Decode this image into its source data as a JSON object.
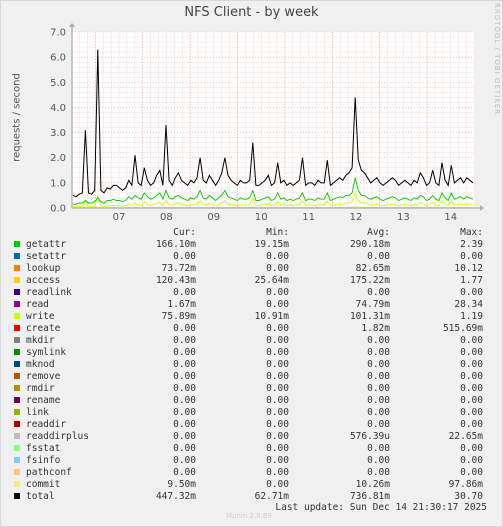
{
  "chart_data": {
    "type": "line",
    "title": "NFS Client - by week",
    "ylabel": "requests / second",
    "ylim": [
      0,
      7
    ],
    "yticks": [
      "0.0",
      "1.0",
      "2.0",
      "3.0",
      "4.0",
      "5.0",
      "6.0",
      "7.0"
    ],
    "x_day_labels": [
      "07",
      "08",
      "09",
      "10",
      "11",
      "12",
      "13",
      "14"
    ],
    "grid": true,
    "series": [
      {
        "name": "total",
        "color": "#000000",
        "values": [
          0.5,
          0.45,
          0.55,
          0.6,
          3.1,
          0.6,
          0.55,
          0.7,
          6.3,
          0.7,
          0.6,
          0.8,
          0.75,
          0.9,
          0.9,
          0.8,
          0.7,
          0.8,
          1.1,
          0.9,
          2.1,
          1.0,
          0.9,
          1.6,
          1.1,
          0.9,
          1.0,
          1.3,
          1.5,
          0.9,
          3.3,
          1.1,
          0.9,
          1.2,
          1.4,
          1.1,
          1.0,
          0.9,
          1.1,
          1.0,
          1.2,
          2.0,
          1.1,
          1.0,
          1.3,
          1.1,
          0.9,
          1.1,
          1.4,
          2.0,
          1.3,
          1.1,
          1.0,
          0.9,
          1.1,
          1.0,
          1.0,
          1.1,
          2.6,
          0.9,
          0.9,
          1.0,
          1.1,
          1.3,
          0.9,
          1.0,
          1.8,
          1.0,
          1.1,
          0.9,
          1.0,
          0.9,
          1.0,
          1.1,
          2.0,
          0.9,
          1.0,
          1.0,
          0.9,
          1.1,
          1.0,
          1.0,
          1.9,
          0.9,
          1.0,
          1.1,
          1.2,
          1.1,
          1.3,
          1.4,
          1.6,
          4.4,
          1.9,
          1.5,
          1.4,
          1.2,
          1.0,
          1.1,
          1.2,
          1.0,
          0.9,
          1.0,
          1.1,
          1.2,
          1.1,
          0.9,
          1.0,
          1.1,
          1.0,
          0.9,
          1.1,
          1.0,
          1.4,
          1.2,
          0.9,
          1.0,
          1.5,
          1.0,
          0.9,
          1.8,
          1.1,
          0.9,
          1.7,
          1.0,
          1.1,
          1.2,
          1.0,
          1.2,
          1.1,
          1.0
        ]
      },
      {
        "name": "getattr",
        "color": "#00cc00",
        "values": [
          0.15,
          0.15,
          0.2,
          0.2,
          0.3,
          0.2,
          0.2,
          0.25,
          0.4,
          0.25,
          0.2,
          0.3,
          0.3,
          0.35,
          0.3,
          0.3,
          0.25,
          0.3,
          0.45,
          0.35,
          0.5,
          0.4,
          0.35,
          0.6,
          0.45,
          0.35,
          0.4,
          0.5,
          0.6,
          0.35,
          0.7,
          0.4,
          0.35,
          0.45,
          0.5,
          0.4,
          0.35,
          0.3,
          0.4,
          0.35,
          0.45,
          0.7,
          0.4,
          0.35,
          0.5,
          0.4,
          0.3,
          0.4,
          0.5,
          0.7,
          0.45,
          0.4,
          0.35,
          0.3,
          0.4,
          0.35,
          0.35,
          0.4,
          0.7,
          0.3,
          0.3,
          0.35,
          0.4,
          0.45,
          0.3,
          0.35,
          0.6,
          0.35,
          0.4,
          0.3,
          0.35,
          0.3,
          0.35,
          0.4,
          0.6,
          0.3,
          0.35,
          0.35,
          0.3,
          0.4,
          0.35,
          0.35,
          0.6,
          0.3,
          0.35,
          0.4,
          0.45,
          0.4,
          0.5,
          0.5,
          0.6,
          1.2,
          0.7,
          0.5,
          0.5,
          0.4,
          0.35,
          0.4,
          0.45,
          0.35,
          0.3,
          0.35,
          0.4,
          0.45,
          0.4,
          0.3,
          0.35,
          0.4,
          0.35,
          0.3,
          0.4,
          0.35,
          0.5,
          0.45,
          0.3,
          0.35,
          0.5,
          0.35,
          0.3,
          0.6,
          0.4,
          0.3,
          0.6,
          0.35,
          0.4,
          0.45,
          0.35,
          0.45,
          0.4,
          0.35
        ]
      },
      {
        "name": "write",
        "color": "#ccff00",
        "values": [
          0.05,
          0.05,
          0.06,
          0.06,
          0.3,
          0.06,
          0.05,
          0.07,
          0.5,
          0.08,
          0.06,
          0.09,
          0.08,
          0.1,
          0.1,
          0.09,
          0.08,
          0.09,
          0.15,
          0.1,
          0.2,
          0.12,
          0.1,
          0.25,
          0.14,
          0.1,
          0.12,
          0.18,
          0.22,
          0.1,
          0.3,
          0.13,
          0.1,
          0.16,
          0.2,
          0.13,
          0.12,
          0.1,
          0.13,
          0.12,
          0.16,
          0.3,
          0.13,
          0.12,
          0.18,
          0.13,
          0.1,
          0.13,
          0.2,
          0.3,
          0.16,
          0.13,
          0.12,
          0.1,
          0.13,
          0.12,
          0.12,
          0.13,
          0.4,
          0.1,
          0.1,
          0.12,
          0.13,
          0.16,
          0.1,
          0.12,
          0.25,
          0.12,
          0.13,
          0.1,
          0.12,
          0.1,
          0.12,
          0.13,
          0.3,
          0.1,
          0.12,
          0.12,
          0.1,
          0.13,
          0.12,
          0.12,
          0.28,
          0.1,
          0.12,
          0.13,
          0.16,
          0.13,
          0.18,
          0.2,
          0.25,
          0.6,
          0.3,
          0.2,
          0.2,
          0.16,
          0.12,
          0.13,
          0.16,
          0.12,
          0.1,
          0.12,
          0.13,
          0.16,
          0.13,
          0.1,
          0.12,
          0.13,
          0.12,
          0.1,
          0.13,
          0.12,
          0.2,
          0.16,
          0.1,
          0.12,
          0.22,
          0.12,
          0.1,
          0.3,
          0.13,
          0.1,
          0.28,
          0.12,
          0.13,
          0.16,
          0.12,
          0.16,
          0.13,
          0.12
        ]
      },
      {
        "name": "commit",
        "color": "#ffe680",
        "values": [
          0.01,
          0.01,
          0.01,
          0.01,
          0.02,
          0.01,
          0.01,
          0.01,
          0.03,
          0.01,
          0.01,
          0.01,
          0.01,
          0.02,
          0.02,
          0.01,
          0.01,
          0.01,
          0.02,
          0.02,
          0.03,
          0.02,
          0.02,
          0.03,
          0.02,
          0.02,
          0.02,
          0.02,
          0.03,
          0.02,
          0.04,
          0.02,
          0.02,
          0.02,
          0.03,
          0.02,
          0.02,
          0.02,
          0.02,
          0.02,
          0.02,
          0.03,
          0.02,
          0.02,
          0.02,
          0.02,
          0.02,
          0.02,
          0.03,
          0.03,
          0.02,
          0.02,
          0.02,
          0.02,
          0.02,
          0.02,
          0.02,
          0.02,
          0.04,
          0.02,
          0.02,
          0.02,
          0.02,
          0.02,
          0.02,
          0.02,
          0.03,
          0.02,
          0.02,
          0.02,
          0.02,
          0.02,
          0.02,
          0.02,
          0.03,
          0.02,
          0.02,
          0.02,
          0.02,
          0.02,
          0.02,
          0.02,
          0.03,
          0.02,
          0.02,
          0.02,
          0.02,
          0.02,
          0.02,
          0.03,
          0.03,
          0.06,
          0.04,
          0.03,
          0.03,
          0.02,
          0.02,
          0.02,
          0.02,
          0.02,
          0.02,
          0.02,
          0.02,
          0.02,
          0.02,
          0.02,
          0.02,
          0.02,
          0.02,
          0.02,
          0.02,
          0.02,
          0.03,
          0.02,
          0.02,
          0.02,
          0.03,
          0.02,
          0.02,
          0.03,
          0.02,
          0.02,
          0.03,
          0.02,
          0.02,
          0.02,
          0.02,
          0.02,
          0.02,
          0.02
        ]
      }
    ],
    "legend_columns": [
      "Cur:",
      "Min:",
      "Avg:",
      "Max:"
    ],
    "legend": [
      {
        "name": "getattr",
        "color": "#00cc00",
        "cur": "166.10m",
        "min": "19.15m",
        "avg": "290.18m",
        "max": "2.39"
      },
      {
        "name": "setattr",
        "color": "#0066b3",
        "cur": "0.00",
        "min": "0.00",
        "avg": "0.00",
        "max": "0.00"
      },
      {
        "name": "lookup",
        "color": "#ff8000",
        "cur": "73.72m",
        "min": "0.00",
        "avg": "82.65m",
        "max": "10.12"
      },
      {
        "name": "access",
        "color": "#ffcc00",
        "cur": "120.43m",
        "min": "25.64m",
        "avg": "175.22m",
        "max": "1.77"
      },
      {
        "name": "readlink",
        "color": "#330099",
        "cur": "0.00",
        "min": "0.00",
        "avg": "0.00",
        "max": "0.00"
      },
      {
        "name": "read",
        "color": "#990099",
        "cur": "1.67m",
        "min": "0.00",
        "avg": "74.79m",
        "max": "28.34"
      },
      {
        "name": "write",
        "color": "#ccff00",
        "cur": "75.89m",
        "min": "10.91m",
        "avg": "101.31m",
        "max": "1.19"
      },
      {
        "name": "create",
        "color": "#ff0000",
        "cur": "0.00",
        "min": "0.00",
        "avg": "1.82m",
        "max": "515.69m"
      },
      {
        "name": "mkdir",
        "color": "#808080",
        "cur": "0.00",
        "min": "0.00",
        "avg": "0.00",
        "max": "0.00"
      },
      {
        "name": "symlink",
        "color": "#008f00",
        "cur": "0.00",
        "min": "0.00",
        "avg": "0.00",
        "max": "0.00"
      },
      {
        "name": "mknod",
        "color": "#00487d",
        "cur": "0.00",
        "min": "0.00",
        "avg": "0.00",
        "max": "0.00"
      },
      {
        "name": "remove",
        "color": "#b35a00",
        "cur": "0.00",
        "min": "0.00",
        "avg": "0.00",
        "max": "0.00"
      },
      {
        "name": "rmdir",
        "color": "#b38f00",
        "cur": "0.00",
        "min": "0.00",
        "avg": "0.00",
        "max": "0.00"
      },
      {
        "name": "rename",
        "color": "#6b006b",
        "cur": "0.00",
        "min": "0.00",
        "avg": "0.00",
        "max": "0.00"
      },
      {
        "name": "link",
        "color": "#8fb300",
        "cur": "0.00",
        "min": "0.00",
        "avg": "0.00",
        "max": "0.00"
      },
      {
        "name": "readdir",
        "color": "#b30000",
        "cur": "0.00",
        "min": "0.00",
        "avg": "0.00",
        "max": "0.00"
      },
      {
        "name": "readdirplus",
        "color": "#bebebe",
        "cur": "0.00",
        "min": "0.00",
        "avg": "576.39u",
        "max": "22.65m"
      },
      {
        "name": "fsstat",
        "color": "#80ff80",
        "cur": "0.00",
        "min": "0.00",
        "avg": "0.00",
        "max": "0.00"
      },
      {
        "name": "fsinfo",
        "color": "#80c9ff",
        "cur": "0.00",
        "min": "0.00",
        "avg": "0.00",
        "max": "0.00"
      },
      {
        "name": "pathconf",
        "color": "#ffc080",
        "cur": "0.00",
        "min": "0.00",
        "avg": "0.00",
        "max": "0.00"
      },
      {
        "name": "commit",
        "color": "#ffe680",
        "cur": "9.50m",
        "min": "0.00",
        "avg": "10.26m",
        "max": "97.86m"
      },
      {
        "name": "total",
        "color": "#000000",
        "cur": "447.32m",
        "min": "62.71m",
        "avg": "736.81m",
        "max": "30.70"
      }
    ]
  },
  "vendor_text": "RRDTOOL / TOBI OETIKER",
  "footer": {
    "last_update": "Last update: Sun Dec 14 21:30:17 2025",
    "generator": "Munin 2.0.69"
  }
}
